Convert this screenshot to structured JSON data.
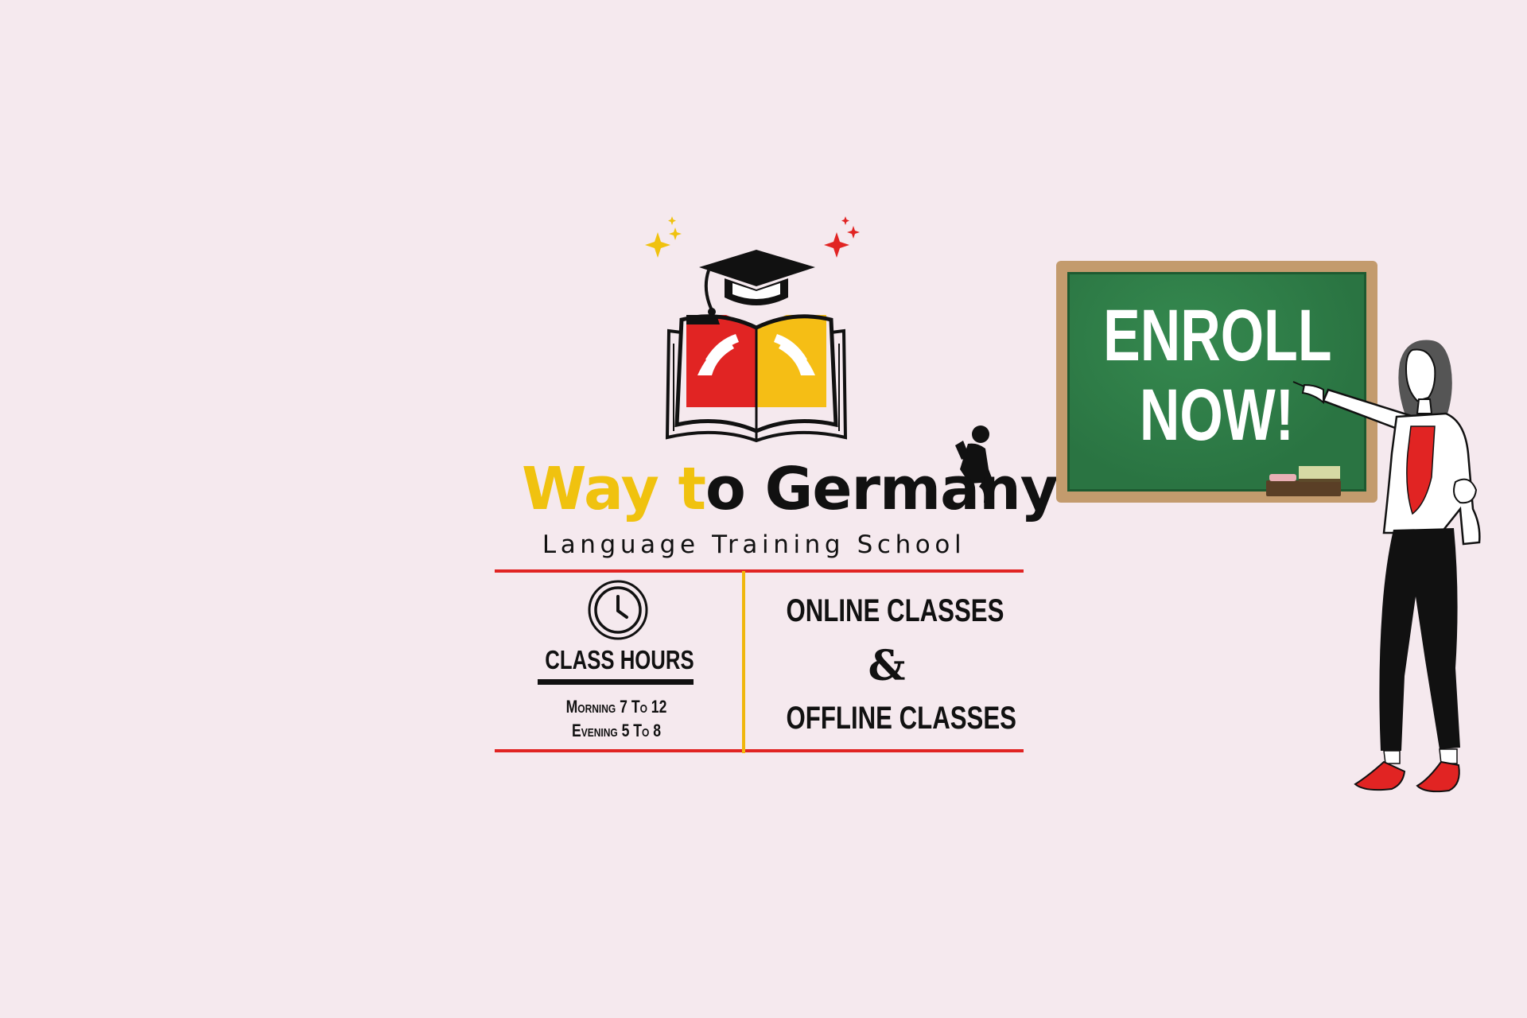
{
  "logo": {
    "title_part1": "Way ",
    "title_part2": "t",
    "title_part3": "o Germany",
    "subtitle": "Language Training School",
    "icons": [
      "graduation-cap-icon",
      "open-book-icon",
      "hands-icon",
      "reading-child-icon",
      "sparkle-icon"
    ]
  },
  "info": {
    "hours_icon": "clock-icon",
    "hours_title": "CLASS HOURS",
    "hours_lines": [
      "Morning 7 To 12",
      "Evening 5 To 8"
    ],
    "mode_line1": "ONLINE CLASSES",
    "mode_connector": "&",
    "mode_line2": "OFFLINE CLASSES"
  },
  "board": {
    "line1": "ENROLL",
    "line2": "NOW!"
  },
  "colors": {
    "background": "#f5e9ee",
    "red": "#e12423",
    "yellow": "#f0c20f",
    "board_green": "#2c7a45",
    "board_frame": "#c39b6d"
  }
}
